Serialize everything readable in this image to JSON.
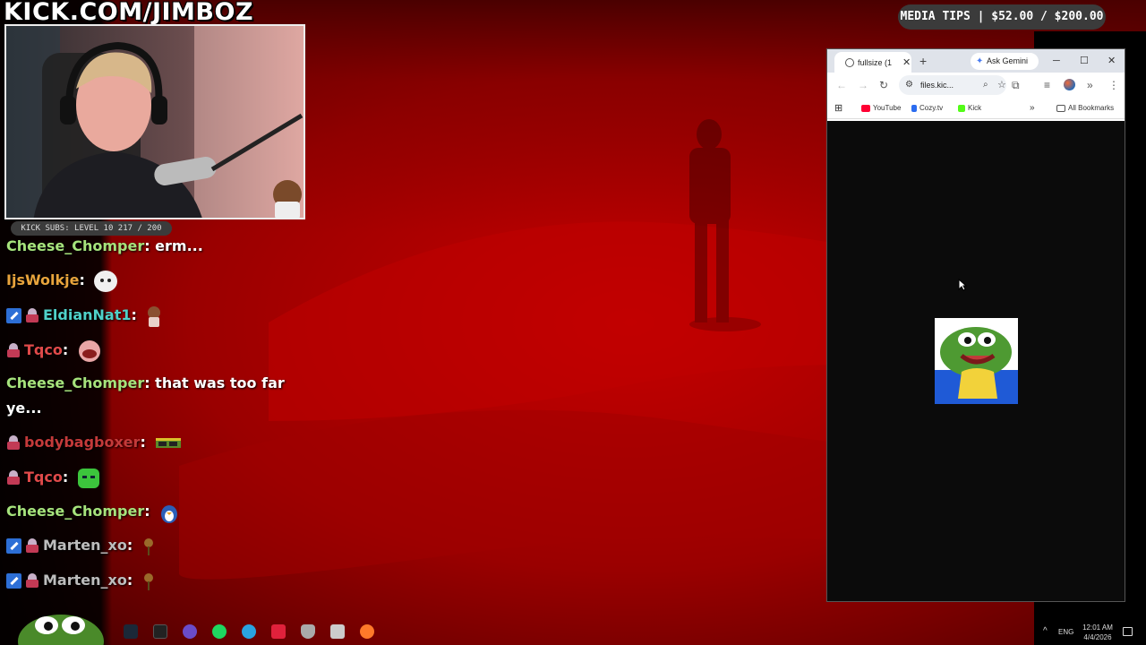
{
  "overlay": {
    "channel_url": "KICK.COM/JIMBOZ",
    "subs_goal": "KICK SUBS: LEVEL 10 217 / 200",
    "media_tips": "MEDIA TIPS | $52.00 / $200.00"
  },
  "chat": [
    {
      "user": "Cheese_Chomper",
      "color": "#a6e37c",
      "text": "erm...",
      "badges": [],
      "emote": null
    },
    {
      "user": "IjsWolkje",
      "color": "#e8a43c",
      "text": "",
      "badges": [],
      "emote": "white-ghost-emote"
    },
    {
      "user": "EldianNat1",
      "color": "#4fd1c9",
      "text": "",
      "badges": [
        "mod",
        "sub"
      ],
      "emote": "anime-girl-emote"
    },
    {
      "user": "Tqco",
      "color": "#e04a4a",
      "text": "",
      "badges": [
        "sub"
      ],
      "emote": "big-mouth-emote"
    },
    {
      "user": "Cheese_Chomper",
      "color": "#a6e37c",
      "text": "that was too far",
      "text2": "ye...",
      "badges": [],
      "emote": null
    },
    {
      "user": "bodybagboxer",
      "color": "#c43a3a",
      "text": "",
      "badges": [
        "sub"
      ],
      "emote": "sunglasses-emote"
    },
    {
      "user": "Tqco",
      "color": "#e04a4a",
      "text": "",
      "badges": [
        "sub"
      ],
      "emote": "green-face-emote"
    },
    {
      "user": "Cheese_Chomper",
      "color": "#a6e37c",
      "text": "",
      "badges": [],
      "emote": "penguin-emote"
    },
    {
      "user": "Marten_xo",
      "color": "#bdbdbd",
      "text": "",
      "badges": [
        "mod",
        "sub"
      ],
      "emote": "flower-emote"
    },
    {
      "user": "Marten_xo",
      "color": "#bdbdbd",
      "text": "",
      "badges": [
        "mod",
        "sub"
      ],
      "emote": "flower-emote"
    }
  ],
  "browser": {
    "tab_title": "fullsize (1",
    "gemini_label": "Ask Gemini",
    "url": "files.kic...",
    "bookmarks": [
      {
        "label": "YouTube",
        "color": "#ff0033"
      },
      {
        "label": "Cozy.tv",
        "color": "#2b6cf0"
      },
      {
        "label": "Kick",
        "color": "#53fc18"
      }
    ],
    "all_bookmarks": "All Bookmarks"
  },
  "taskbar": {
    "language": "ENG",
    "time": "12:01 AM",
    "date": "4/4/2026",
    "icons": [
      {
        "name": "steam-icon",
        "color": "#1b2838"
      },
      {
        "name": "terminal-icon",
        "color": "#222"
      },
      {
        "name": "obs-icon",
        "color": "#6a4cc9"
      },
      {
        "name": "spotify-icon",
        "color": "#1ed760"
      },
      {
        "name": "telegram-icon",
        "color": "#2aa3e0"
      },
      {
        "name": "adobe-icon",
        "color": "#e0213b"
      },
      {
        "name": "shield-icon",
        "color": "#aaa"
      },
      {
        "name": "files-icon",
        "color": "#ccc"
      },
      {
        "name": "settings-icon",
        "color": "#ff7a2a"
      }
    ]
  },
  "colors": {
    "scene_red": "#8e0000",
    "pill_bg": "#3b3b3b"
  }
}
